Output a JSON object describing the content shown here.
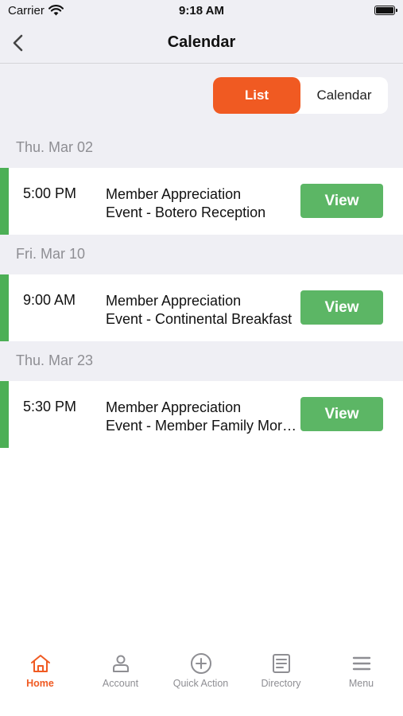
{
  "status": {
    "carrier": "Carrier",
    "time": "9:18 AM"
  },
  "nav": {
    "title": "Calendar"
  },
  "segment": {
    "list_label": "List",
    "calendar_label": "Calendar",
    "selected": "List"
  },
  "days": [
    {
      "date": "Thu. Mar 02",
      "event": {
        "time": "5:00 PM",
        "title_line1": "Member Appreciation",
        "title_line2": "Event - Botero Reception",
        "button": "View"
      }
    },
    {
      "date": "Fri. Mar 10",
      "event": {
        "time": "9:00 AM",
        "title_line1": "Member Appreciation",
        "title_line2": "Event - Continental Breakfast",
        "button": "View"
      }
    },
    {
      "date": "Thu. Mar 23",
      "event": {
        "time": "5:30 PM",
        "title_line1": "Member Appreciation",
        "title_line2": "Event - Member Family Morning",
        "button": "View"
      }
    }
  ],
  "tabs": [
    {
      "label": "Home",
      "icon": "home-icon",
      "active": true
    },
    {
      "label": "Account",
      "icon": "person-icon",
      "active": false
    },
    {
      "label": "Quick Action",
      "icon": "plus-circle-icon",
      "active": false
    },
    {
      "label": "Directory",
      "icon": "directory-icon",
      "active": false
    },
    {
      "label": "Menu",
      "icon": "hamburger-menu-icon",
      "active": false
    }
  ],
  "colors": {
    "accent_orange": "#f05a22",
    "event_green": "#5cb665",
    "accent_bar_green": "#4caf55",
    "background_gray": "#efeff4"
  }
}
